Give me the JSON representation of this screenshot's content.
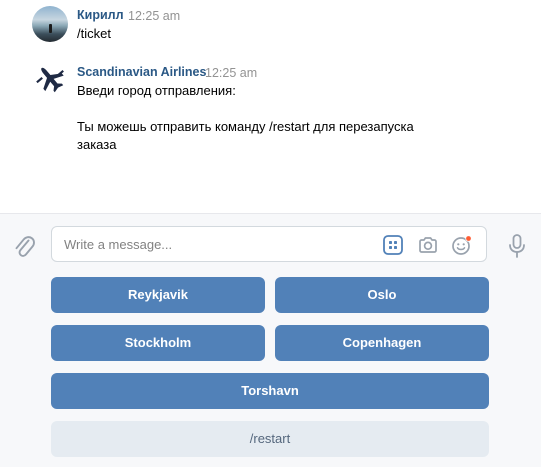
{
  "messages": [
    {
      "author": "Кирилл",
      "time": "12:25 am",
      "text": "/ticket",
      "avatar": "user-photo-avatar"
    },
    {
      "author": "Scandinavian Airlines",
      "time": "12:25 am",
      "lines": [
        "Введи город отправления:",
        "Ты можешь отправить команду /restart для перезапуска",
        "заказа"
      ],
      "avatar": "airplane-logo-icon"
    }
  ],
  "composer": {
    "placeholder": "Write a message...",
    "icons": [
      "attach-icon",
      "keyboard-icon",
      "camera-icon",
      "emoji-icon",
      "microphone-icon"
    ]
  },
  "keyboard": {
    "buttons": [
      {
        "label": "Reykjavik",
        "style": "primary"
      },
      {
        "label": "Oslo",
        "style": "primary"
      },
      {
        "label": "Stockholm",
        "style": "primary"
      },
      {
        "label": "Copenhagen",
        "style": "primary"
      },
      {
        "label": "Torshavn",
        "style": "primary"
      },
      {
        "label": "/restart",
        "style": "secondary"
      }
    ]
  },
  "colors": {
    "primary_button": "#5181b8",
    "secondary_button": "#e5ebf1",
    "author_name": "#2a5885",
    "notification_dot": "#ff5c33"
  }
}
